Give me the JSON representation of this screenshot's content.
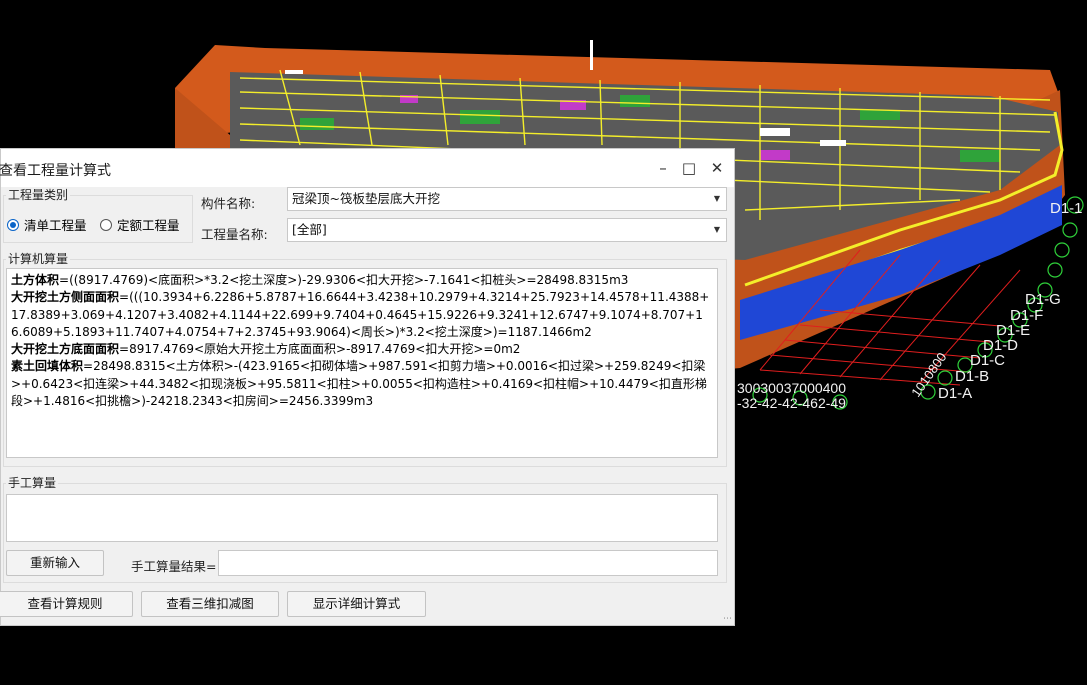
{
  "scene": {
    "axis_labels": [
      "D1-A",
      "D1-B",
      "D1-C",
      "D1-D",
      "D1-E",
      "D1-F",
      "D1-G",
      "D1-1"
    ],
    "bottom_labels": [
      "1010800",
      "30030037000400",
      "-32-42-42-462-49"
    ]
  },
  "dialog": {
    "title": "查看工程量计算式",
    "quantity_type": {
      "legend": "工程量类别",
      "options": [
        "清单工程量",
        "定额工程量"
      ],
      "selected": "清单工程量"
    },
    "component_label": "构件名称:",
    "component_value": "冠梁顶~筏板垫层底大开挖",
    "quantity_name_label": "工程量名称:",
    "quantity_name_value": "[全部]",
    "computer_section": "计算机算量",
    "formulas": [
      {
        "name": "土方体积",
        "expr": "=((8917.4769)<底面积>*3.2<挖土深度>)-29.9306<扣大开挖>-7.1641<扣桩头>=28498.8315m3"
      },
      {
        "name": "大开挖土方侧面面积",
        "expr": "=(((10.3934+6.2286+5.8787+16.6644+3.4238+10.2979+4.3214+25.7923+14.4578+11.4388+17.8389+3.069+4.1207+3.4082+4.1144+22.699+9.7404+0.4645+15.9226+9.3241+12.6747+9.1074+8.707+16.6089+5.1893+11.7407+4.0754+7+2.3745+93.9064)<周长>)*3.2<挖土深度>)=1187.1466m2"
      },
      {
        "name": "大开挖土方底面面积",
        "expr": "=8917.4769<原始大开挖土方底面面积>-8917.4769<扣大开挖>=0m2"
      },
      {
        "name": "素土回填体积",
        "expr": "=28498.8315<土方体积>-(423.9165<扣砌体墙>+987.591<扣剪力墙>+0.0016<扣过梁>+259.8249<扣梁>+0.6423<扣连梁>+44.3482<扣现浇板>+95.5811<扣柱>+0.0055<扣构造柱>+0.4169<扣柱帽>+10.4479<扣直形梯段>+1.4816<扣挑檐>)-24218.2343<扣房间>=2456.3399m3"
      }
    ],
    "manual_section": "手工算量",
    "reenter_button": "重新输入",
    "manual_result_label": "手工算量结果=",
    "manual_result_value": "",
    "buttons": [
      "查看计算规则",
      "查看三维扣减图",
      "显示详细计算式"
    ]
  }
}
